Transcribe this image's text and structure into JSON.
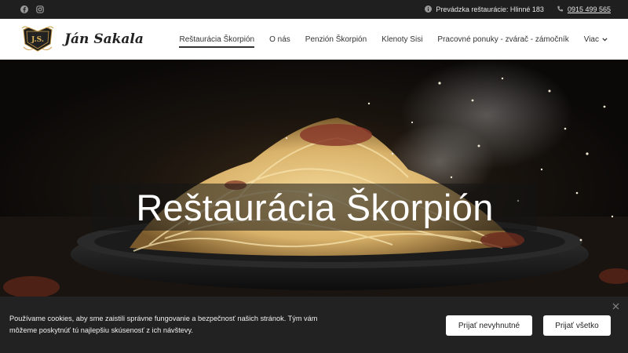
{
  "topbar": {
    "social": [
      {
        "icon": "facebook-icon"
      },
      {
        "icon": "instagram-icon"
      }
    ],
    "address_label": "Prevádzka reštaurácie: Hlinné 183",
    "phone": "0915 499 565"
  },
  "header": {
    "logo_initials": "J.S.",
    "logo_name": "Ján Sakala",
    "nav": [
      {
        "label": "Reštaurácia Škorpión",
        "active": true
      },
      {
        "label": "O nás"
      },
      {
        "label": "Penzión Škorpión"
      },
      {
        "label": "Klenoty Sisi"
      },
      {
        "label": "Pracovné ponuky - zvárač - zámočník"
      }
    ],
    "more_label": "Viac"
  },
  "hero": {
    "title": "Reštaurácia Škorpión"
  },
  "cookie": {
    "text": "Používame cookies, aby sme zaistili správne fungovanie a bezpečnosť našich stránok. Tým vám môžeme poskytnúť tú najlepšiu skúsenosť z ich návštevy.",
    "accept_necessary": "Prijať nevyhnutné",
    "accept_all": "Prijať všetko"
  },
  "colors": {
    "topbar_bg": "#1f1f1f",
    "header_bg": "#ffffff",
    "cookie_bg": "#222222",
    "hero_bg": "#0b0908"
  }
}
